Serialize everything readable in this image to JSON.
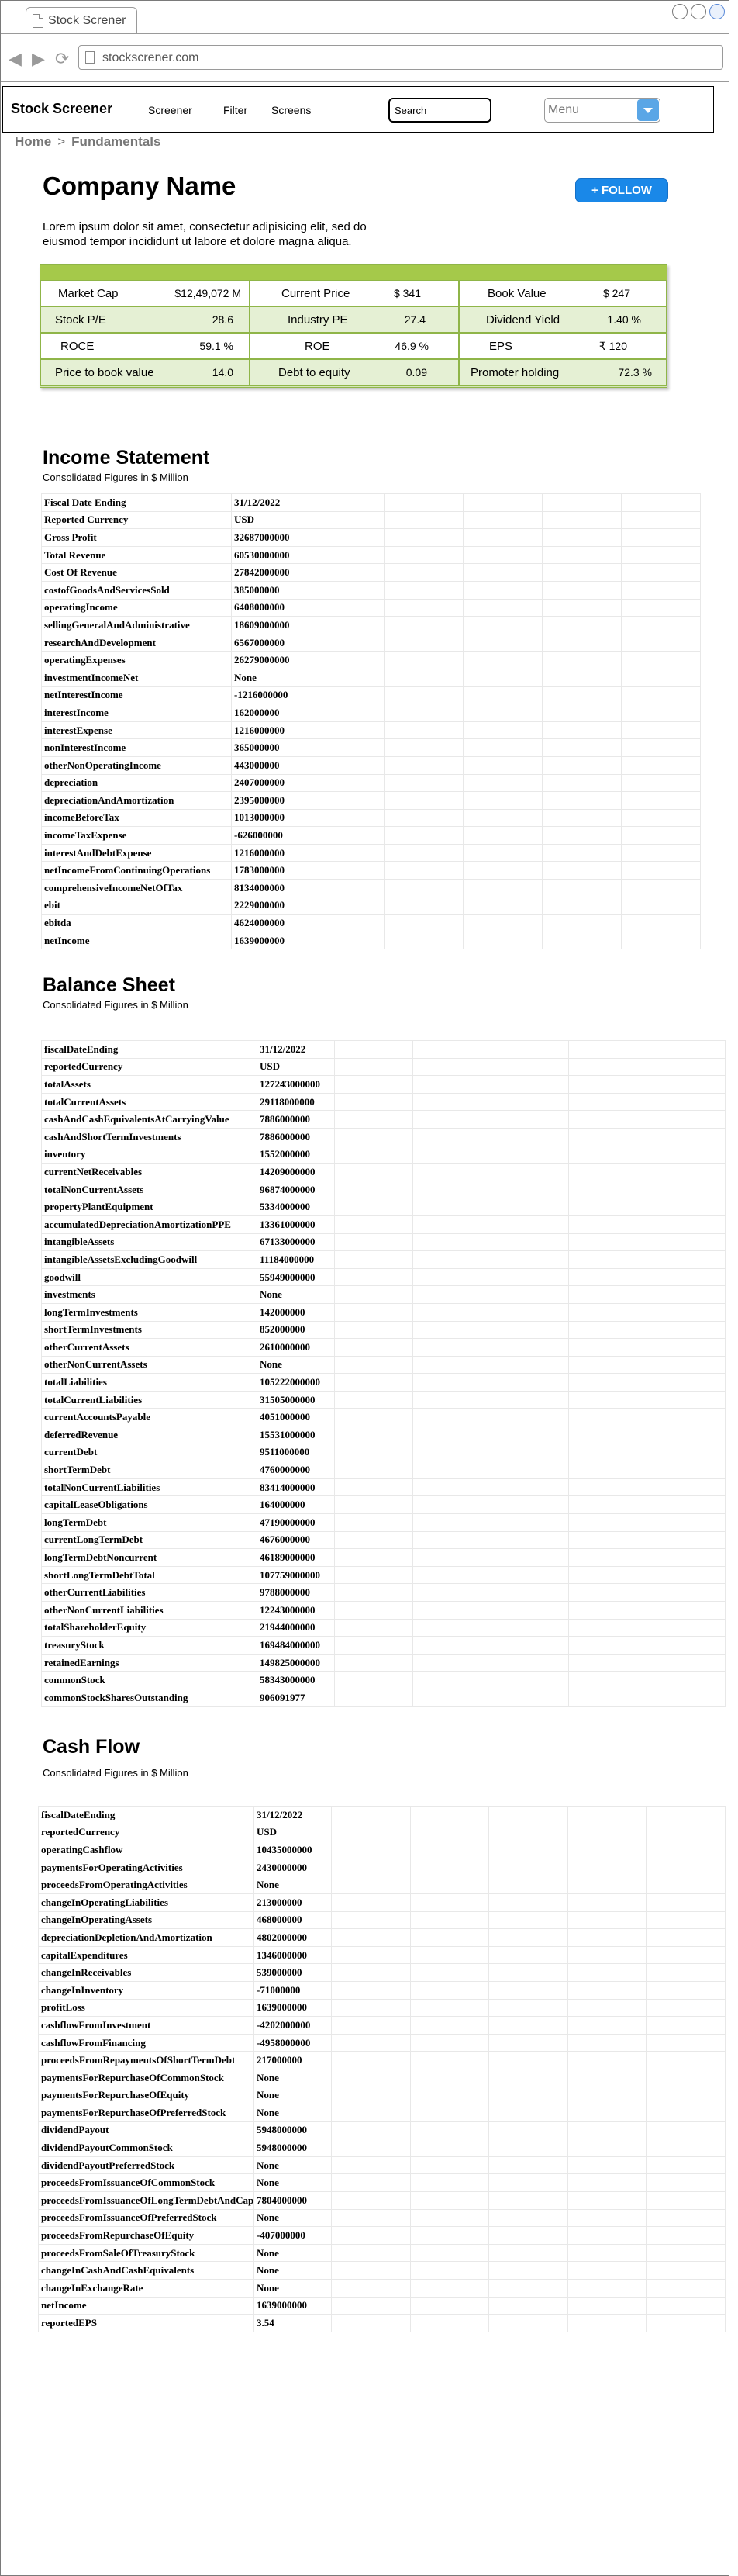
{
  "browser": {
    "tab_title": "Stock Screner",
    "url": "stockscrener.com"
  },
  "header": {
    "brand": "Stock Screener",
    "nav": [
      "Screener",
      "Filter",
      "Screens"
    ],
    "search_value": "Search",
    "menu_label": "Menu"
  },
  "breadcrumb": {
    "home": "Home",
    "separator": ">",
    "current": "Fundamentals"
  },
  "company": {
    "name": "Company Name",
    "follow_label": "+ FOLLOW",
    "description": "Lorem ipsum dolor sit amet, consectetur adipisicing elit, sed do eiusmod tempor incididunt ut labore et dolore magna aliqua."
  },
  "colors": {
    "accent_button": "#1a88e8",
    "metrics_header": "#a5c94a",
    "metrics_row": "#e5f0d4"
  },
  "metrics": [
    [
      {
        "label": "Market Cap",
        "value": "$12,49,072 M"
      },
      {
        "label": "Current Price",
        "value": "$ 341"
      },
      {
        "label": "Book Value",
        "value": "$ 247"
      }
    ],
    [
      {
        "label": "Stock P/E",
        "value": "28.6"
      },
      {
        "label": "Industry PE",
        "value": "27.4"
      },
      {
        "label": "Dividend Yield",
        "value": "1.40 %"
      }
    ],
    [
      {
        "label": "ROCE",
        "value": "59.1 %"
      },
      {
        "label": "ROE",
        "value": "46.9 %"
      },
      {
        "label": "EPS",
        "value": "₹ 120"
      }
    ],
    [
      {
        "label": "Price to book value",
        "value": "14.0"
      },
      {
        "label": "Debt to equity",
        "value": "0.09"
      },
      {
        "label": "Promoter holding",
        "value": "72.3 %"
      }
    ]
  ],
  "income_statement": {
    "title": "Income Statement",
    "subtitle": "Consolidated Figures in $ Million",
    "rows": [
      [
        "Fiscal Date Ending",
        "31/12/2022"
      ],
      [
        "Reported Currency",
        "USD"
      ],
      [
        "Gross Profit",
        "32687000000"
      ],
      [
        "Total Revenue",
        "60530000000"
      ],
      [
        "Cost Of Revenue",
        "27842000000"
      ],
      [
        "costofGoodsAndServicesSold",
        "385000000"
      ],
      [
        "operatingIncome",
        "6408000000"
      ],
      [
        "sellingGeneralAndAdministrative",
        "18609000000"
      ],
      [
        "researchAndDevelopment",
        "6567000000"
      ],
      [
        "operatingExpenses",
        "26279000000"
      ],
      [
        "investmentIncomeNet",
        "None"
      ],
      [
        "netInterestIncome",
        "-1216000000"
      ],
      [
        "interestIncome",
        "162000000"
      ],
      [
        "interestExpense",
        "1216000000"
      ],
      [
        "nonInterestIncome",
        "365000000"
      ],
      [
        "otherNonOperatingIncome",
        "443000000"
      ],
      [
        "depreciation",
        "2407000000"
      ],
      [
        "depreciationAndAmortization",
        "2395000000"
      ],
      [
        "incomeBeforeTax",
        "1013000000"
      ],
      [
        "incomeTaxExpense",
        "-626000000"
      ],
      [
        "interestAndDebtExpense",
        "1216000000"
      ],
      [
        "netIncomeFromContinuingOperations",
        "1783000000"
      ],
      [
        "comprehensiveIncomeNetOfTax",
        "8134000000"
      ],
      [
        "ebit",
        "2229000000"
      ],
      [
        "ebitda",
        "4624000000"
      ],
      [
        "netIncome",
        "1639000000"
      ]
    ]
  },
  "balance_sheet": {
    "title": "Balance Sheet",
    "subtitle": "Consolidated Figures in $ Million",
    "rows": [
      [
        "fiscalDateEnding",
        "31/12/2022"
      ],
      [
        "reportedCurrency",
        "USD"
      ],
      [
        "totalAssets",
        "127243000000"
      ],
      [
        "totalCurrentAssets",
        "29118000000"
      ],
      [
        "cashAndCashEquivalentsAtCarryingValue",
        "7886000000"
      ],
      [
        "cashAndShortTermInvestments",
        "7886000000"
      ],
      [
        "inventory",
        "1552000000"
      ],
      [
        "currentNetReceivables",
        "14209000000"
      ],
      [
        "totalNonCurrentAssets",
        "96874000000"
      ],
      [
        "propertyPlantEquipment",
        "5334000000"
      ],
      [
        "accumulatedDepreciationAmortizationPPE",
        "13361000000"
      ],
      [
        "intangibleAssets",
        "67133000000"
      ],
      [
        "intangibleAssetsExcludingGoodwill",
        "11184000000"
      ],
      [
        "goodwill",
        "55949000000"
      ],
      [
        "investments",
        "None"
      ],
      [
        "longTermInvestments",
        "142000000"
      ],
      [
        "shortTermInvestments",
        "852000000"
      ],
      [
        "otherCurrentAssets",
        "2610000000"
      ],
      [
        "otherNonCurrentAssets",
        "None"
      ],
      [
        "totalLiabilities",
        "105222000000"
      ],
      [
        "totalCurrentLiabilities",
        "31505000000"
      ],
      [
        "currentAccountsPayable",
        "4051000000"
      ],
      [
        "deferredRevenue",
        "15531000000"
      ],
      [
        "currentDebt",
        "9511000000"
      ],
      [
        "shortTermDebt",
        "4760000000"
      ],
      [
        "totalNonCurrentLiabilities",
        "83414000000"
      ],
      [
        "capitalLeaseObligations",
        "164000000"
      ],
      [
        "longTermDebt",
        "47190000000"
      ],
      [
        "currentLongTermDebt",
        "4676000000"
      ],
      [
        "longTermDebtNoncurrent",
        "46189000000"
      ],
      [
        "shortLongTermDebtTotal",
        "107759000000"
      ],
      [
        "otherCurrentLiabilities",
        "9788000000"
      ],
      [
        "otherNonCurrentLiabilities",
        "12243000000"
      ],
      [
        "totalShareholderEquity",
        "21944000000"
      ],
      [
        "treasuryStock",
        "169484000000"
      ],
      [
        "retainedEarnings",
        "149825000000"
      ],
      [
        "commonStock",
        "58343000000"
      ],
      [
        "commonStockSharesOutstanding",
        "906091977"
      ]
    ]
  },
  "cash_flow": {
    "title": "Cash Flow",
    "subtitle": "Consolidated Figures in $ Million",
    "rows": [
      [
        "fiscalDateEnding",
        "31/12/2022"
      ],
      [
        "reportedCurrency",
        "USD"
      ],
      [
        "operatingCashflow",
        "10435000000"
      ],
      [
        "paymentsForOperatingActivities",
        "2430000000"
      ],
      [
        "proceedsFromOperatingActivities",
        "None"
      ],
      [
        "changeInOperatingLiabilities",
        "213000000"
      ],
      [
        "changeInOperatingAssets",
        "468000000"
      ],
      [
        "depreciationDepletionAndAmortization",
        "4802000000"
      ],
      [
        "capitalExpenditures",
        "1346000000"
      ],
      [
        "changeInReceivables",
        "539000000"
      ],
      [
        "changeInInventory",
        "-71000000"
      ],
      [
        "profitLoss",
        "1639000000"
      ],
      [
        "cashflowFromInvestment",
        "-4202000000"
      ],
      [
        "cashflowFromFinancing",
        "-4958000000"
      ],
      [
        "proceedsFromRepaymentsOfShortTermDebt",
        "217000000"
      ],
      [
        "paymentsForRepurchaseOfCommonStock",
        "None"
      ],
      [
        "paymentsForRepurchaseOfEquity",
        "None"
      ],
      [
        "paymentsForRepurchaseOfPreferredStock",
        "None"
      ],
      [
        "dividendPayout",
        "5948000000"
      ],
      [
        "dividendPayoutCommonStock",
        "5948000000"
      ],
      [
        "dividendPayoutPreferredStock",
        "None"
      ],
      [
        "proceedsFromIssuanceOfCommonStock",
        "None"
      ],
      [
        "proceedsFromIssuanceOfLongTermDebtAndCapitalSecuritiesNet",
        "7804000000"
      ],
      [
        "proceedsFromIssuanceOfPreferredStock",
        "None"
      ],
      [
        "proceedsFromRepurchaseOfEquity",
        "-407000000"
      ],
      [
        "proceedsFromSaleOfTreasuryStock",
        "None"
      ],
      [
        "changeInCashAndCashEquivalents",
        "None"
      ],
      [
        "changeInExchangeRate",
        "None"
      ],
      [
        "netIncome",
        "1639000000"
      ],
      [
        "reportedEPS",
        "3.54"
      ]
    ]
  }
}
